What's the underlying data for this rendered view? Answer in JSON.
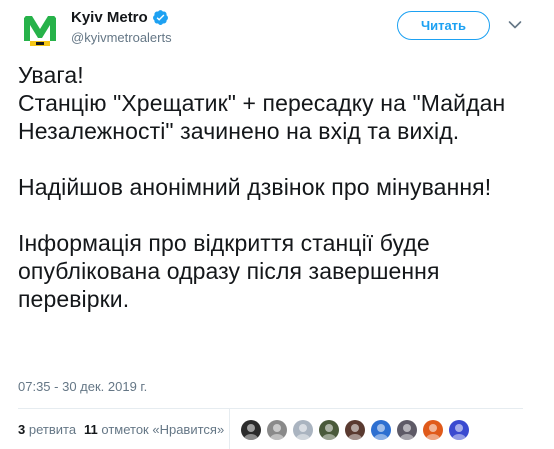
{
  "account": {
    "display_name": "Kyiv Metro",
    "handle": "@kyivmetroalerts",
    "verified": true,
    "brand_color": "#27b24a",
    "avatar_icon": "metro-m-logo-icon"
  },
  "follow_button": {
    "label": "Читать"
  },
  "menu_icon": "chevron-down-icon",
  "tweet": {
    "text": "Увага!\nСтанцію \"Хрещатик\" + пересадку на \"Майдан Незалежності\" зачинено на вхід та вихід.\n\nНадійшов анонімний дзвінок про мінування!\n\nІнформація про відкриття станції буде опублікована одразу після завершення перевірки."
  },
  "timestamp": "07:35 - 30 дек. 2019 г.",
  "stats": {
    "retweets_count": "3",
    "retweets_label": "ретвита",
    "likes_count": "11",
    "likes_label": "отметок «Нравится»"
  },
  "likers": [
    {
      "icon": "liker-avatar-1",
      "color": "#2b2b2b"
    },
    {
      "icon": "liker-avatar-2",
      "color": "#8a8a8a"
    },
    {
      "icon": "liker-avatar-3",
      "color": "#aab4c0"
    },
    {
      "icon": "liker-avatar-4",
      "color": "#4a5a3a"
    },
    {
      "icon": "liker-avatar-5",
      "color": "#5a3a30"
    },
    {
      "icon": "liker-avatar-6",
      "color": "#2d6fd1"
    },
    {
      "icon": "liker-avatar-7",
      "color": "#5e5a66"
    },
    {
      "icon": "liker-avatar-8",
      "color": "#e05a1a"
    },
    {
      "icon": "liker-avatar-9",
      "color": "#3a4ad0"
    }
  ],
  "colors": {
    "link_blue": "#1da1f2",
    "secondary_text": "#657786",
    "primary_text": "#14171a",
    "divider": "#e6ecf0"
  }
}
